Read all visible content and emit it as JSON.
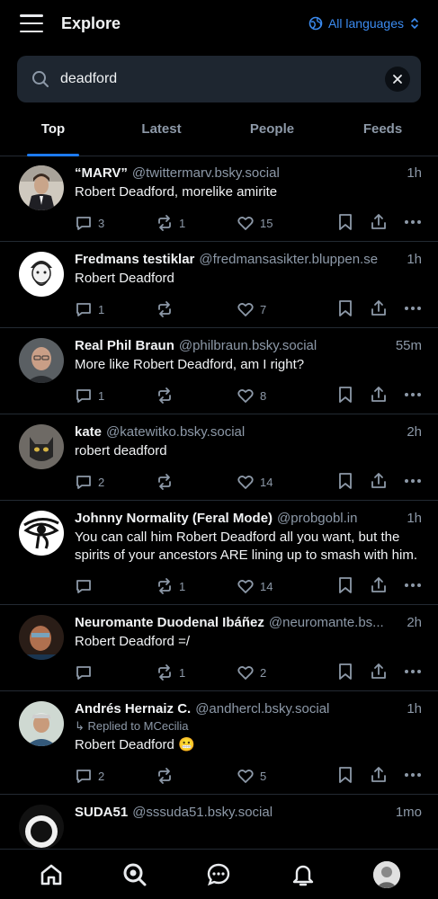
{
  "header": {
    "title": "Explore",
    "language": "All languages"
  },
  "search": {
    "query": "deadford"
  },
  "tabs": [
    "Top",
    "Latest",
    "People",
    "Feeds"
  ],
  "posts": [
    {
      "name": "“MARV”",
      "handle": "@twittermarv.bsky.social",
      "time": "1h",
      "reply_to": "",
      "text": "Robert Deadford, morelike amirite",
      "replies": "3",
      "reposts": "1",
      "likes": "15"
    },
    {
      "name": "Fredmans testiklar",
      "handle": "@fredmansasikter.bluppen.se",
      "time": "1h",
      "reply_to": "",
      "text": "Robert Deadford",
      "replies": "1",
      "reposts": "",
      "likes": "7"
    },
    {
      "name": "Real Phil Braun",
      "handle": "@philbraun.bsky.social",
      "time": "55m",
      "reply_to": "",
      "text": "More like Robert Deadford, am I right?",
      "replies": "1",
      "reposts": "",
      "likes": "8"
    },
    {
      "name": "kate",
      "handle": "@katewitko.bsky.social",
      "time": "2h",
      "reply_to": "",
      "text": "robert deadford",
      "replies": "2",
      "reposts": "",
      "likes": "14"
    },
    {
      "name": "Johnny Normality (Feral Mode)",
      "handle": "@probgobl.in",
      "time": "1h",
      "reply_to": "",
      "text": "You can call him Robert Deadford all you want, but the spirits of your ancestors ARE lining up to smash with him.",
      "replies": "",
      "reposts": "1",
      "likes": "14"
    },
    {
      "name": "Neuromante Duodenal Ibáñez",
      "handle": "@neuromante.bs...",
      "time": "2h",
      "reply_to": "",
      "text": "Robert Deadford =/",
      "replies": "",
      "reposts": "1",
      "likes": "2"
    },
    {
      "name": "Andrés Hernaiz C.",
      "handle": "@andhercl.bsky.social",
      "time": "1h",
      "reply_to": "Replied to MCecilia",
      "text": "Robert Deadford 😬",
      "replies": "2",
      "reposts": "",
      "likes": "5"
    },
    {
      "name": "SUDA51",
      "handle": "@sssuda51.bsky.social",
      "time": "1mo",
      "reply_to": "",
      "text": "",
      "replies": "",
      "reposts": "",
      "likes": ""
    }
  ],
  "colors": {
    "accent": "#1d7bf0",
    "link": "#3b8bf0",
    "muted": "#8d99a8",
    "background": "#000000"
  },
  "icons": {
    "menu": "menu-icon",
    "language": "globe-icon",
    "search": "search-icon",
    "clear": "close-icon"
  },
  "nav": [
    "home-icon",
    "search-icon",
    "chat-icon",
    "bell-icon",
    "profile-avatar"
  ]
}
